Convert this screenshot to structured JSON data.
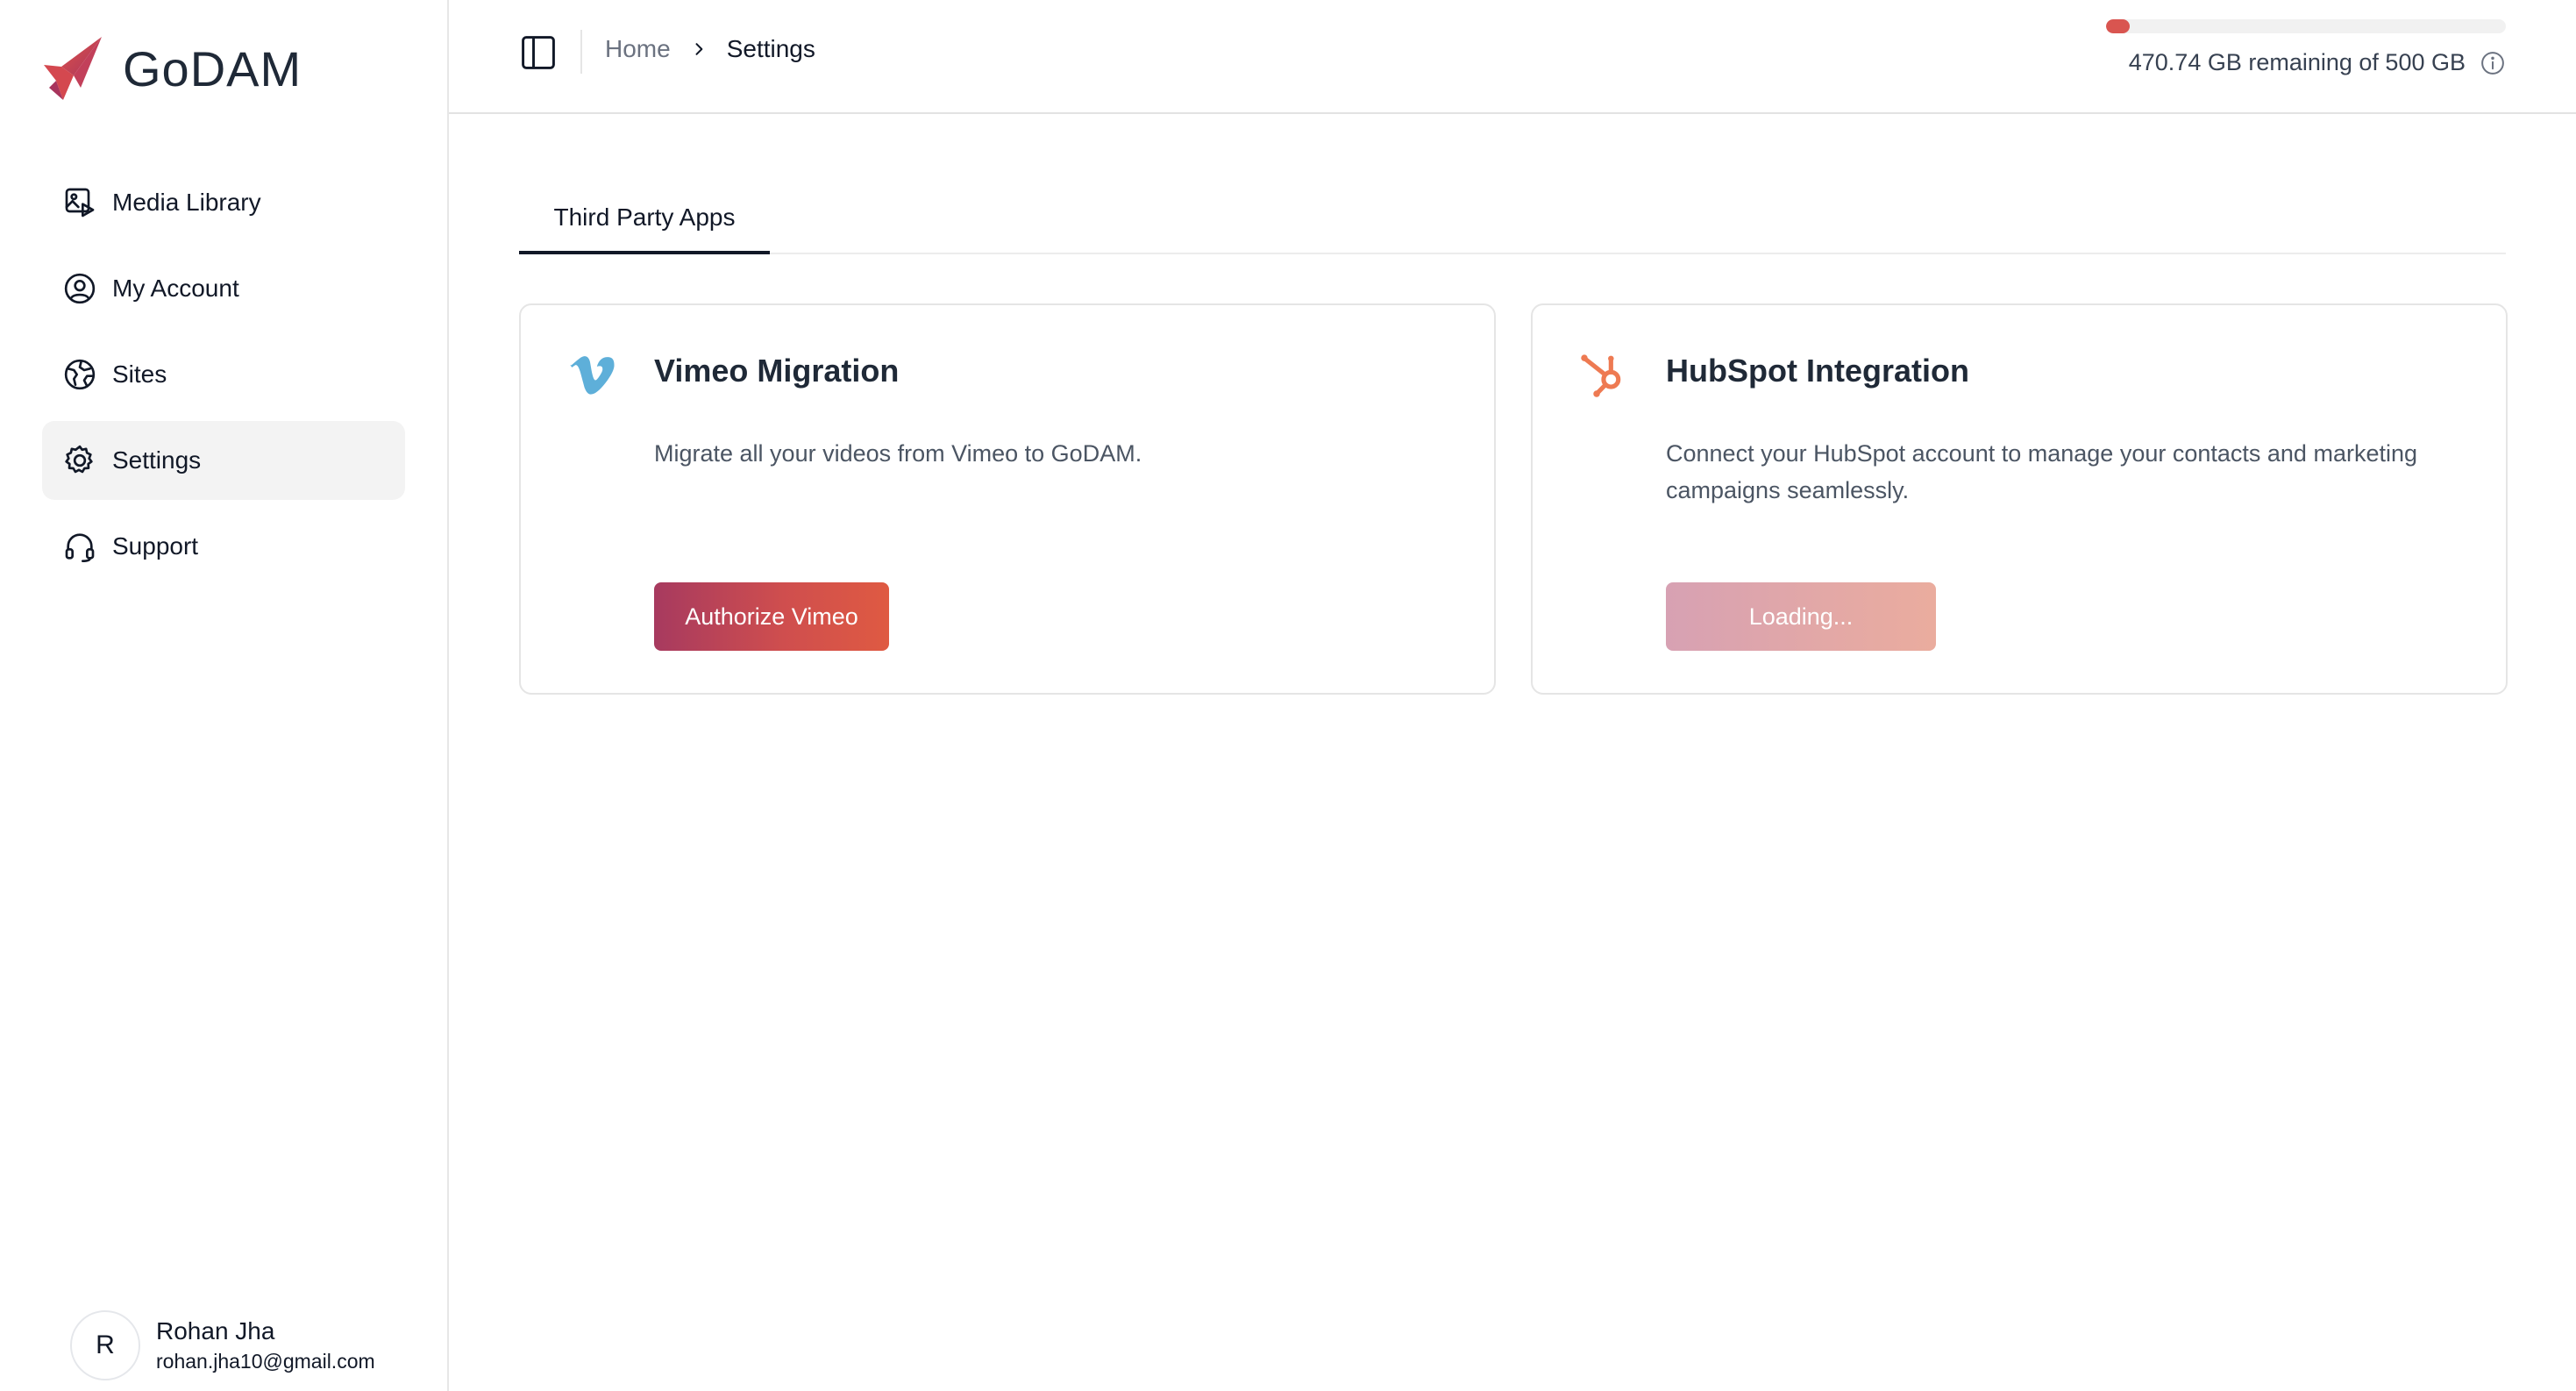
{
  "app": {
    "name": "GoDAM"
  },
  "sidebar": {
    "items": [
      {
        "label": "Media Library",
        "icon": "media-library-icon"
      },
      {
        "label": "My Account",
        "icon": "user-circle-icon"
      },
      {
        "label": "Sites",
        "icon": "globe-icon"
      },
      {
        "label": "Settings",
        "icon": "gear-icon",
        "active": true
      },
      {
        "label": "Support",
        "icon": "headset-icon"
      }
    ],
    "user": {
      "initial": "R",
      "name": "Rohan Jha",
      "email": "rohan.jha10@gmail.com"
    }
  },
  "header": {
    "breadcrumb": {
      "home": "Home",
      "current": "Settings"
    },
    "storage": {
      "text": "470.74 GB remaining of 500 GB",
      "used_fraction": 0.0585
    }
  },
  "tabs": [
    {
      "label": "Third Party Apps",
      "active": true
    }
  ],
  "cards": {
    "vimeo": {
      "title": "Vimeo Migration",
      "description": "Migrate all your videos from Vimeo to GoDAM.",
      "button_label": "Authorize Vimeo",
      "icon": "vimeo-icon"
    },
    "hubspot": {
      "title": "HubSpot Integration",
      "description": "Connect your HubSpot account to manage your contacts and marketing campaigns seamlessly.",
      "button_label": "Loading...",
      "icon": "hubspot-icon"
    }
  },
  "colors": {
    "accent_start": "#a73a5f",
    "accent_end": "#df5a42",
    "storage_fill": "#d95550",
    "hubspot_orange": "#ee7a52",
    "vimeo_blue": "#5eafd9"
  }
}
